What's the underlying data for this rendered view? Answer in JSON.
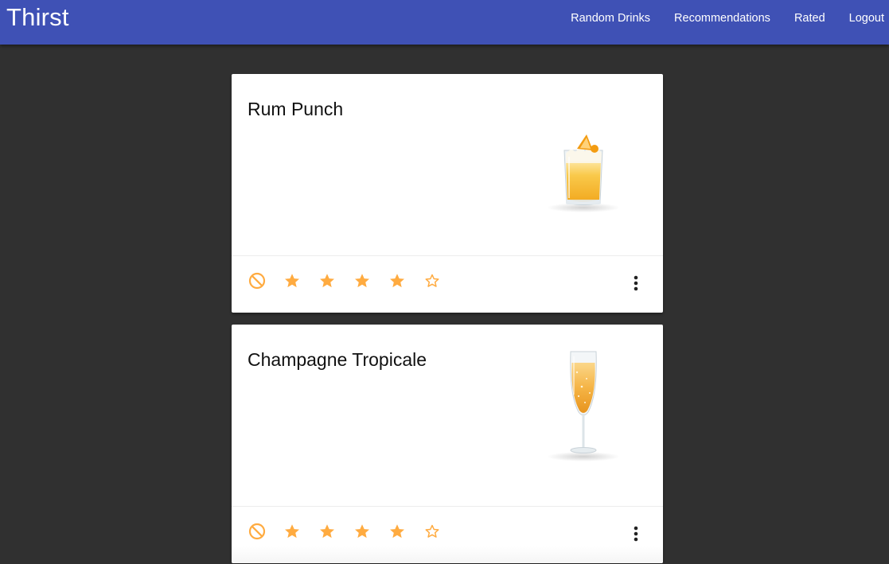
{
  "header": {
    "brand": "Thirst",
    "nav": [
      "Random Drinks",
      "Recommendations",
      "Rated",
      "Logout"
    ]
  },
  "colors": {
    "appbar": "#3f51b5",
    "background": "#303030",
    "rating": "#ffab40"
  },
  "cards": [
    {
      "title": "Rum Punch",
      "image": "rum-punch-glass",
      "rating": 4,
      "max_rating": 5
    },
    {
      "title": "Champagne Tropicale",
      "image": "champagne-flute",
      "rating": 4,
      "max_rating": 5
    }
  ]
}
